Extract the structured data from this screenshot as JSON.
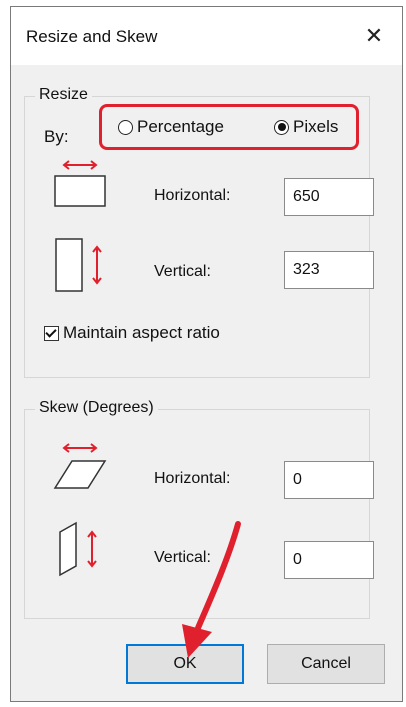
{
  "dialog": {
    "title": "Resize and Skew",
    "close_glyph": "✕"
  },
  "resize": {
    "legend": "Resize",
    "by_label": "By:",
    "options": [
      {
        "label": "Percentage",
        "selected": false
      },
      {
        "label": "Pixels",
        "selected": true
      }
    ],
    "horizontal_label": "Horizontal:",
    "horizontal_value": "650",
    "vertical_label": "Vertical:",
    "vertical_value": "323",
    "maintain_aspect_label": "Maintain aspect ratio",
    "maintain_aspect_checked": true
  },
  "skew": {
    "legend": "Skew (Degrees)",
    "horizontal_label": "Horizontal:",
    "horizontal_value": "0",
    "vertical_label": "Vertical:",
    "vertical_value": "0"
  },
  "buttons": {
    "ok": "OK",
    "cancel": "Cancel"
  },
  "colors": {
    "highlight": "#e0202c",
    "accent": "#0078d7"
  }
}
